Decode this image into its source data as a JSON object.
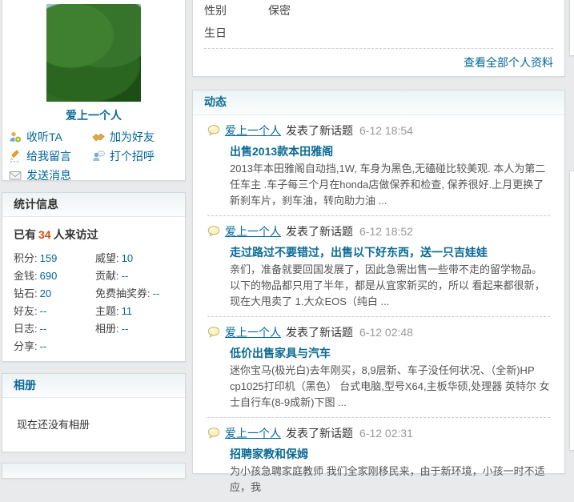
{
  "colors": {
    "link_blue": "#006997",
    "header_blue": "#0b6a94",
    "visitor_orange": "#c8500f",
    "page_bg": "#e9eaeb"
  },
  "profile": {
    "username": "爱上一个人",
    "actions": [
      {
        "label": "收听TA",
        "icon": "listen-icon"
      },
      {
        "label": "加为好友",
        "icon": "handshake-icon"
      },
      {
        "label": "给我留言",
        "icon": "pencil-icon"
      },
      {
        "label": "打个招呼",
        "icon": "hello-icon"
      },
      {
        "label": "发送消息",
        "icon": "envelope-icon"
      }
    ]
  },
  "stats": {
    "title": "统计信息",
    "visitors_prefix": "已有",
    "visitors_count": "34",
    "visitors_suffix": "人来访过",
    "items": [
      {
        "label": "积分:",
        "value": "159"
      },
      {
        "label": "威望:",
        "value": "10"
      },
      {
        "label": "金钱:",
        "value": "690"
      },
      {
        "label": "贡献:",
        "value": "--"
      },
      {
        "label": "钻石:",
        "value": "20"
      },
      {
        "label": "免费抽奖券:",
        "value": "--"
      },
      {
        "label": "好友:",
        "value": "--"
      },
      {
        "label": "主题:",
        "value": "11"
      },
      {
        "label": "日志:",
        "value": "--"
      },
      {
        "label": "相册:",
        "value": "--"
      },
      {
        "label": "分享:",
        "value": "--"
      }
    ]
  },
  "album": {
    "title": "相册",
    "empty_text": "现在还没有相册"
  },
  "info": {
    "gender_label": "性别",
    "gender_value": "保密",
    "birthday_label": "生日",
    "birthday_value": "",
    "view_all": "查看全部个人资料"
  },
  "feed": {
    "title": "动态",
    "items": [
      {
        "user": "爱上一个人",
        "action": "发表了新话题",
        "time": "6-12 18:54",
        "title": "出售2013款本田雅阁",
        "body": "2013年本田雅阁自动挡,1W, 车身为黑色,无磕碰比较美观. 本人为第二任车主 .车子每三个月在honda店做保养和检查, 保养很好.上月更换了新刹车片，刹车油，转向助力油 ..."
      },
      {
        "user": "爱上一个人",
        "action": "发表了新话题",
        "time": "6-12 18:52",
        "title": "走过路过不要错过，出售以下好东西，送一只吉娃娃",
        "body": "亲们，准备就要回国发展了，因此急需出售一些带不走的留学物品。以下的物品都只用了半年，都是从宜家新买的，所以 看起来都很新，现在大甩卖了 1.大众EOS（纯白 ..."
      },
      {
        "user": "爱上一个人",
        "action": "发表了新话题",
        "time": "6-12 02:48",
        "title": "低价出售家具与汽车",
        "body": "迷你宝马(极光白)去年刚买，8,9层新、车子没任何状况、（全新)HP cp1025打印机（黑色） 台式电脑,型号X64,主板华硕,处理器 英特尔 女士自行车(8-9成新)下图 ..."
      },
      {
        "user": "爱上一个人",
        "action": "发表了新话题",
        "time": "6-12 02:31",
        "title": "招聘家教和保姆",
        "body": "为小孩急聘家庭教师 我们全家刚移民来，由于新环境，小孩一时不适应，我"
      }
    ]
  }
}
